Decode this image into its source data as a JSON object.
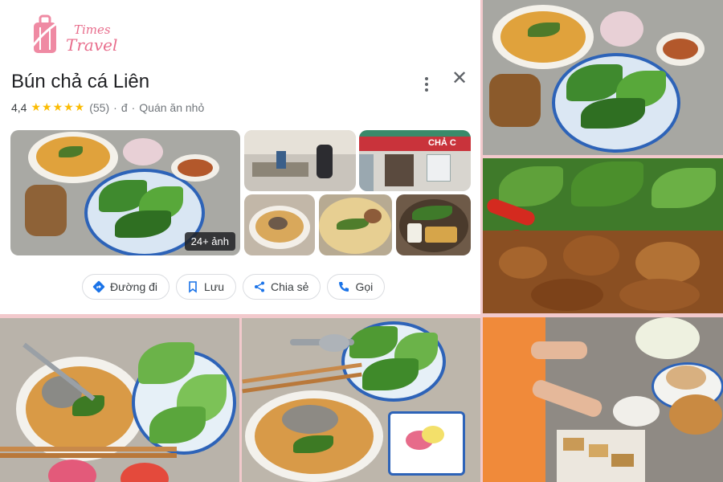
{
  "logo": {
    "line1": "Times",
    "line2": "Travel"
  },
  "place": {
    "name": "Bún chả cá Liên",
    "rating": "4,4",
    "stars": "★★★★★",
    "reviews": "(55)",
    "price": "đ",
    "category": "Quán ăn nhỏ"
  },
  "gallery": {
    "more_photos": "24+ ảnh"
  },
  "actions": {
    "directions": "Đường đi",
    "save": "Lưu",
    "share": "Chia sẻ",
    "call": "Gọi"
  },
  "storefront_sign": "CHẢ C",
  "colors": {
    "star": "#fbbc04",
    "accent": "#1a73e8",
    "frame": "#f2c9cc",
    "logo": "#e86d8c"
  }
}
